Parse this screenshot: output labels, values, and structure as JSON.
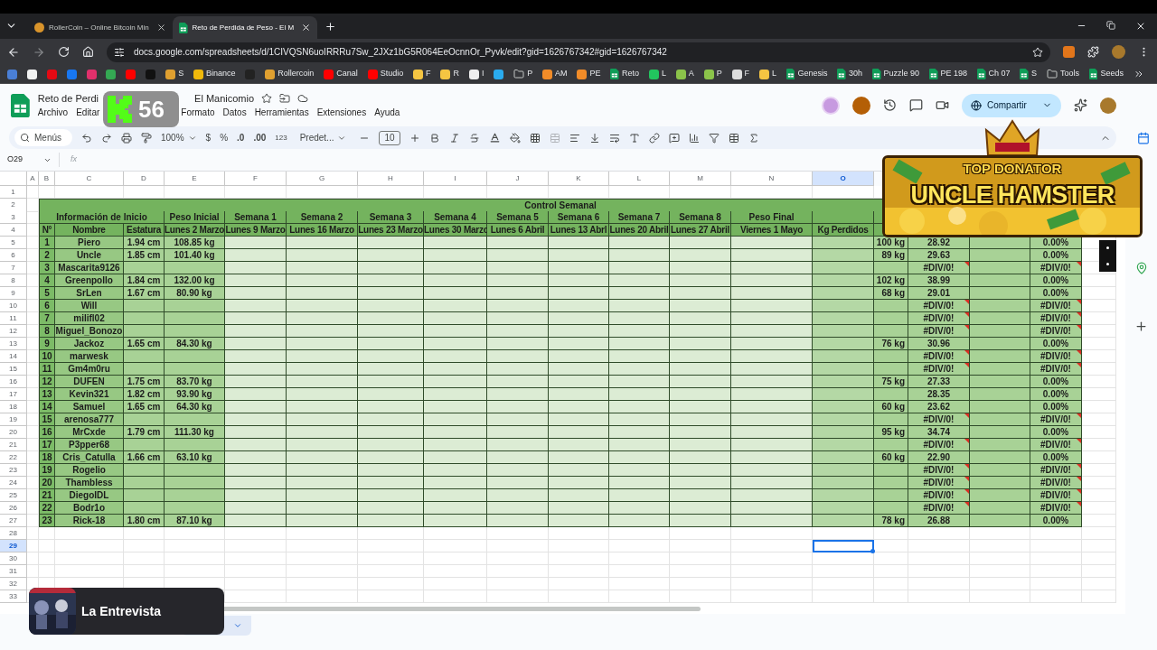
{
  "browser": {
    "tabs": [
      {
        "title": "RollerCoin – Online Bitcoin Min",
        "selected": false,
        "kind": "site"
      },
      {
        "title": "Reto de Perdida de Peso - El M",
        "selected": true,
        "kind": "sheet"
      }
    ],
    "url": "docs.google.com/spreadsheets/d/1CIVQSN6uoIRRRu7Sw_2JXz1bG5R064EeOcnnOr_Pyvk/edit?gid=1626767342#gid=1626767342",
    "bookmarks": [
      {
        "kind": "site",
        "color": "#4a7fd6"
      },
      {
        "kind": "site",
        "color": "#f1f1f1"
      },
      {
        "kind": "site",
        "color": "#e50914"
      },
      {
        "kind": "site",
        "color": "#1877f2"
      },
      {
        "kind": "site",
        "color": "#e1306c"
      },
      {
        "kind": "site",
        "color": "#34a853"
      },
      {
        "kind": "site",
        "color": "#ff0000"
      },
      {
        "kind": "site",
        "color": "#111111"
      },
      {
        "kind": "site",
        "color": "#e0a030",
        "label": "S"
      },
      {
        "kind": "site",
        "color": "#f0b90b",
        "label": "Binance"
      },
      {
        "kind": "site",
        "color": "#222222"
      },
      {
        "kind": "site",
        "color": "#e0a030",
        "label": "Rollercoin"
      },
      {
        "kind": "site",
        "color": "#ff0000",
        "label": "Canal"
      },
      {
        "kind": "site",
        "color": "#ff0000",
        "label": "Studio"
      },
      {
        "kind": "site",
        "color": "#f5c542",
        "label": "F"
      },
      {
        "kind": "site",
        "color": "#f5c542",
        "label": "R"
      },
      {
        "kind": "site",
        "color": "#eeeeee",
        "label": "I"
      },
      {
        "kind": "site",
        "color": "#2aabee"
      },
      {
        "kind": "folder",
        "label": "P"
      },
      {
        "kind": "site",
        "color": "#f28c28",
        "label": "AM"
      },
      {
        "kind": "site",
        "color": "#f28c28",
        "label": "PE"
      },
      {
        "kind": "sheet",
        "label": "Reto"
      },
      {
        "kind": "site",
        "color": "#22c55e",
        "label": "L"
      },
      {
        "kind": "site",
        "color": "#8bc34a",
        "label": "A"
      },
      {
        "kind": "site",
        "color": "#8bc34a",
        "label": "P"
      },
      {
        "kind": "site",
        "color": "#dddddd",
        "label": "F"
      },
      {
        "kind": "site",
        "color": "#f5c542",
        "label": "L"
      },
      {
        "kind": "sheet",
        "label": "Genesis"
      },
      {
        "kind": "sheet",
        "label": "30h"
      },
      {
        "kind": "sheet",
        "label": "Puzzle 90"
      },
      {
        "kind": "sheet",
        "label": "PE 198"
      },
      {
        "kind": "sheet",
        "label": "Ch 07"
      },
      {
        "kind": "sheet",
        "label": "S"
      },
      {
        "kind": "folder",
        "label": "Tools"
      },
      {
        "kind": "sheet",
        "label": "Seeds"
      }
    ]
  },
  "doc": {
    "title_parts": [
      "Reto de Perdi",
      "El Manicomio"
    ],
    "menus": [
      "Archivo",
      "Editar",
      "Formato",
      "Datos",
      "Herramientas",
      "Extensiones",
      "Ayuda"
    ],
    "share": "Compartir"
  },
  "toolbar": {
    "search": "Menús",
    "zoom": "100%",
    "currency": "$",
    "percent": "%",
    "dec_less": ".0",
    "dec_more": ".00",
    "number_format": "123",
    "font": "Predet...",
    "font_size": "10"
  },
  "formula_bar": {
    "cell": "O29",
    "fx": "fx"
  },
  "columns": [
    {
      "label": "A",
      "selected": false
    },
    {
      "label": "B",
      "selected": false
    },
    {
      "label": "C",
      "selected": false
    },
    {
      "label": "D",
      "selected": false
    },
    {
      "label": "E",
      "selected": false
    },
    {
      "label": "F",
      "selected": false
    },
    {
      "label": "G",
      "selected": false
    },
    {
      "label": "H",
      "selected": false
    },
    {
      "label": "I",
      "selected": false
    },
    {
      "label": "J",
      "selected": false
    },
    {
      "label": "K",
      "selected": false
    },
    {
      "label": "L",
      "selected": false
    },
    {
      "label": "M",
      "selected": false
    },
    {
      "label": "N",
      "selected": false
    },
    {
      "label": "O",
      "selected": true
    }
  ],
  "row_headers": [
    {
      "label": "1",
      "selected": false
    },
    {
      "label": "2",
      "selected": false
    },
    {
      "label": "3",
      "selected": false
    },
    {
      "label": "4",
      "selected": false
    },
    {
      "label": "5",
      "selected": false
    },
    {
      "label": "6",
      "selected": false
    },
    {
      "label": "7",
      "selected": false
    },
    {
      "label": "8",
      "selected": false
    },
    {
      "label": "9",
      "selected": false
    },
    {
      "label": "10",
      "selected": false
    },
    {
      "label": "11",
      "selected": false
    },
    {
      "label": "12",
      "selected": false
    },
    {
      "label": "13",
      "selected": false
    },
    {
      "label": "14",
      "selected": false
    },
    {
      "label": "15",
      "selected": false
    },
    {
      "label": "16",
      "selected": false
    },
    {
      "label": "17",
      "selected": false
    },
    {
      "label": "18",
      "selected": false
    },
    {
      "label": "19",
      "selected": false
    },
    {
      "label": "20",
      "selected": false
    },
    {
      "label": "21",
      "selected": false
    },
    {
      "label": "22",
      "selected": false
    },
    {
      "label": "23",
      "selected": false
    },
    {
      "label": "24",
      "selected": false
    },
    {
      "label": "25",
      "selected": false
    },
    {
      "label": "26",
      "selected": false
    },
    {
      "label": "27",
      "selected": false
    },
    {
      "label": "28",
      "selected": false
    },
    {
      "label": "29",
      "selected": true
    },
    {
      "label": "30",
      "selected": false
    },
    {
      "label": "31",
      "selected": false
    },
    {
      "label": "32",
      "selected": false
    },
    {
      "label": "33",
      "selected": false
    }
  ],
  "sheet": {
    "title": "Control Semanal",
    "group_headers": [
      "Información de Inicio",
      "Peso Inicial",
      "Semana 1",
      "Semana 2",
      "Semana 3",
      "Semana 4",
      "Semana 5",
      "Semana 6",
      "Semana 7",
      "Semana 8",
      "Peso Final"
    ],
    "headers": [
      "N°",
      "Nombre",
      "Estatura",
      "Lunes 2 Marzo",
      "Lunes 9 Marzo",
      "Lunes 16 Marzo",
      "Lunes 23 Marzo",
      "Lunes 30 Marzo",
      "Lunes 6 Abril",
      "Lunes 13 Abrl",
      "Lunes 20 Abril",
      "Lunes 27 Abril",
      "Viernes 1 Mayo",
      "Kg Perdidos"
    ],
    "rows": [
      {
        "n": "1",
        "name": "Piero",
        "height": "1.94 cm",
        "weight": "108.85 kg",
        "final": "100 kg",
        "bmi": "28.92",
        "pct": "0.00%",
        "error": false
      },
      {
        "n": "2",
        "name": "Uncle",
        "height": "1.85 cm",
        "weight": "101.40 kg",
        "final": "89 kg",
        "bmi": "29.63",
        "pct": "0.00%",
        "error": false
      },
      {
        "n": "3",
        "name": "Mascarita9126",
        "bmi": "#DIV/0!",
        "pct": "#DIV/0!",
        "error": true
      },
      {
        "n": "4",
        "name": "Greenpollo",
        "height": "1.84 cm",
        "weight": "132.00 kg",
        "final": "102 kg",
        "bmi": "38.99",
        "pct": "0.00%",
        "error": false
      },
      {
        "n": "5",
        "name": "SrLen",
        "height": "1.67 cm",
        "weight": "80.90 kg",
        "final": "68 kg",
        "bmi": "29.01",
        "pct": "0.00%",
        "error": false
      },
      {
        "n": "6",
        "name": "Will",
        "bmi": "#DIV/0!",
        "pct": "#DIV/0!",
        "error": true
      },
      {
        "n": "7",
        "name": "milifl02",
        "bmi": "#DIV/0!",
        "pct": "#DIV/0!",
        "error": true
      },
      {
        "n": "8",
        "name": "Miguel_Bonozo",
        "bmi": "#DIV/0!",
        "pct": "#DIV/0!",
        "error": true
      },
      {
        "n": "9",
        "name": "Jackoz",
        "height": "1.65 cm",
        "weight": "84.30 kg",
        "final": "76 kg",
        "bmi": "30.96",
        "pct": "0.00%",
        "error": false
      },
      {
        "n": "10",
        "name": "marwesk",
        "bmi": "#DIV/0!",
        "pct": "#DIV/0!",
        "error": true
      },
      {
        "n": "11",
        "name": "Gm4m0ru",
        "bmi": "#DIV/0!",
        "pct": "#DIV/0!",
        "error": true
      },
      {
        "n": "12",
        "name": "DUFEN",
        "height": "1.75 cm",
        "weight": "83.70 kg",
        "final": "75 kg",
        "bmi": "27.33",
        "pct": "0.00%",
        "error": false
      },
      {
        "n": "13",
        "name": "Kevin321",
        "height": "1.82 cm",
        "weight": "93.90 kg",
        "bmi": "28.35",
        "pct": "0.00%",
        "error": false
      },
      {
        "n": "14",
        "name": "Samuel",
        "height": "1.65 cm",
        "weight": "64.30 kg",
        "final": "60 kg",
        "bmi": "23.62",
        "pct": "0.00%",
        "error": false
      },
      {
        "n": "15",
        "name": "arenosa777",
        "bmi": "#DIV/0!",
        "pct": "#DIV/0!",
        "error": true
      },
      {
        "n": "16",
        "name": "MrCxde",
        "height": "1.79 cm",
        "weight": "111.30 kg",
        "final": "95 kg",
        "bmi": "34.74",
        "pct": "0.00%",
        "error": false
      },
      {
        "n": "17",
        "name": "P3pper68",
        "bmi": "#DIV/0!",
        "pct": "#DIV/0!",
        "error": true
      },
      {
        "n": "18",
        "name": "Cris_Catulla",
        "height": "1.66 cm",
        "weight": "63.10 kg",
        "final": "60 kg",
        "bmi": "22.90",
        "pct": "0.00%",
        "error": false
      },
      {
        "n": "19",
        "name": "Rogelio",
        "bmi": "#DIV/0!",
        "pct": "#DIV/0!",
        "error": true
      },
      {
        "n": "20",
        "name": "Thambless",
        "bmi": "#DIV/0!",
        "pct": "#DIV/0!",
        "error": true
      },
      {
        "n": "21",
        "name": "DiegoIDL",
        "bmi": "#DIV/0!",
        "pct": "#DIV/0!",
        "error": true
      },
      {
        "n": "22",
        "name": "Bodr1o",
        "bmi": "#DIV/0!",
        "pct": "#DIV/0!",
        "error": true
      },
      {
        "n": "23",
        "name": "Rick-18",
        "height": "1.80 cm",
        "weight": "87.10 kg",
        "final": "78 kg",
        "bmi": "26.88",
        "pct": "0.00%",
        "error": false
      }
    ]
  },
  "overlays": {
    "counter": "56",
    "banner_top": "TOP DONATOR",
    "banner_name": "UNCLE HAMSTER",
    "now_playing": "La Entrevista"
  }
}
